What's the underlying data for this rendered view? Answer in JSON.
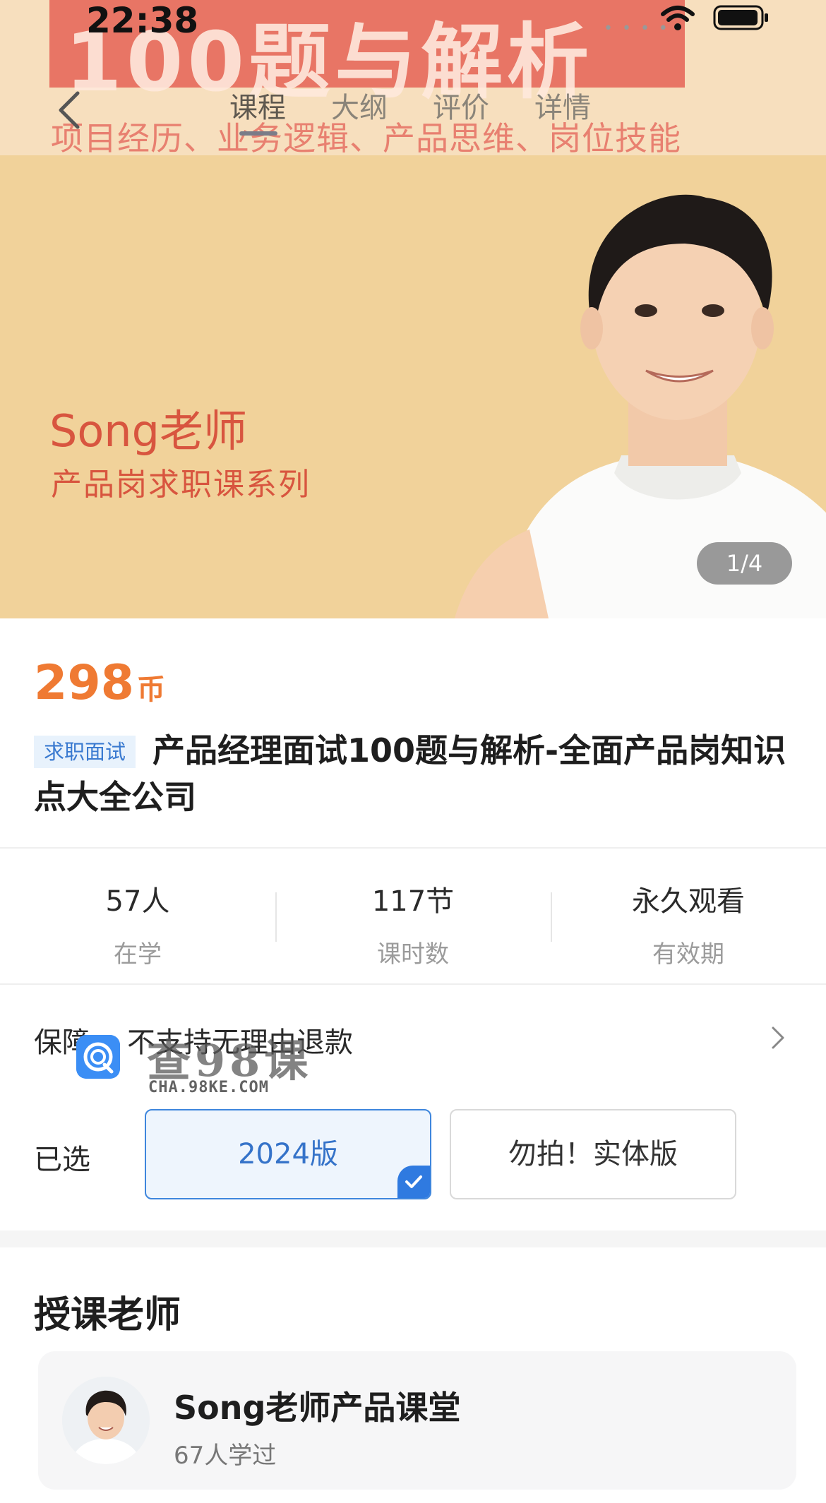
{
  "status_bar": {
    "time": "22:38"
  },
  "hero": {
    "headline": "100题与解析",
    "tagline": "项目经历、业务逻辑、产品思维、岗位技能",
    "teacher_name": "Song老师",
    "series": "产品岗求职课系列",
    "counter": "1/4",
    "icon": "teacher-portrait"
  },
  "nav": {
    "tabs": [
      {
        "label": "课程",
        "active": true
      },
      {
        "label": "大纲",
        "active": false
      },
      {
        "label": "评价",
        "active": false
      },
      {
        "label": "详情",
        "active": false
      }
    ]
  },
  "price": {
    "value": "298",
    "unit": "币",
    "color": "#ef7a33"
  },
  "course": {
    "tag": "求职面试",
    "title": "产品经理面试100题与解析-全面产品岗知识点大全公司"
  },
  "stats": [
    {
      "value": "57人",
      "label": "在学"
    },
    {
      "value": "117节",
      "label": "课时数"
    },
    {
      "value": "永久观看",
      "label": "有效期"
    }
  ],
  "guarantee": {
    "label": "保障",
    "value": "不支持无理由退款"
  },
  "watermark": {
    "text": "查98课",
    "domain": "CHA.98KE.COM"
  },
  "selection": {
    "label": "已选",
    "options": [
      {
        "label": "2024版",
        "selected": true
      },
      {
        "label": "勿拍！实体版",
        "selected": false
      }
    ],
    "accent": "#2f7ae0"
  },
  "teacher_section": {
    "title": "授课老师",
    "name": "Song老师产品课堂",
    "learners": "67人学过"
  }
}
